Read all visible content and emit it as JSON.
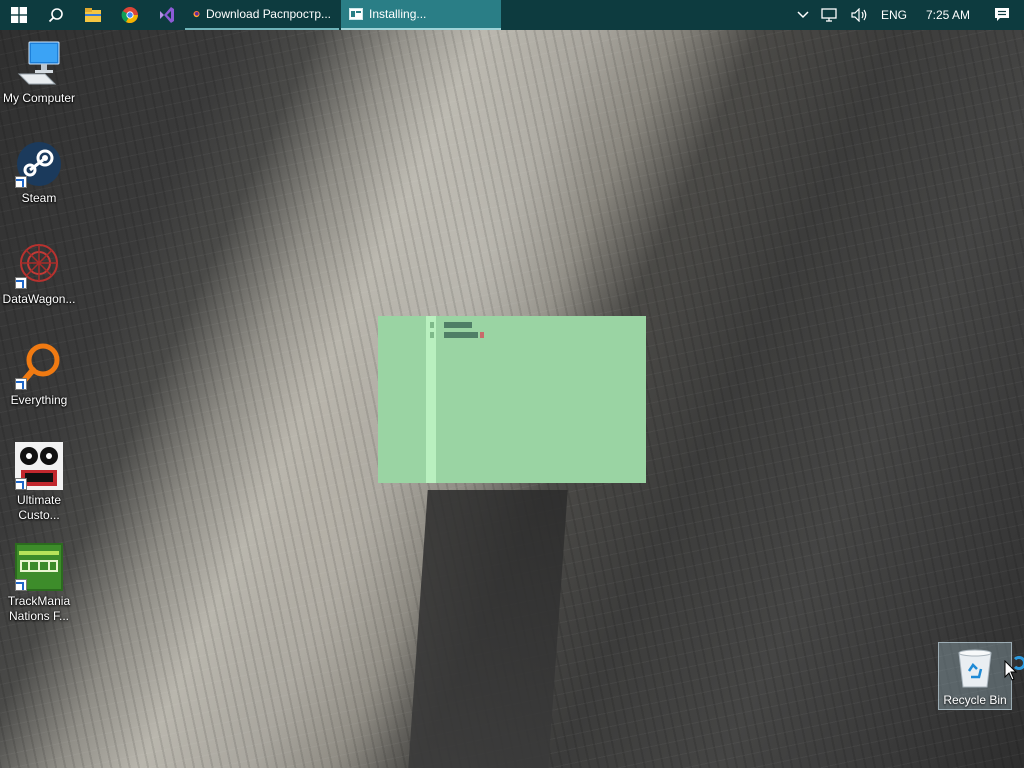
{
  "taskbar": {
    "apps": [
      {
        "label": "Download Распростр...",
        "icon": "firefox-icon"
      },
      {
        "label": "Installing...",
        "icon": "installer-window-icon"
      }
    ],
    "pinned": [
      "start-icon",
      "search-icon",
      "file-explorer-icon",
      "chrome-icon",
      "visual-studio-icon"
    ],
    "tray": {
      "language": "ENG",
      "time": "7:25 AM"
    }
  },
  "desktop": {
    "icons": [
      {
        "name": "my-computer",
        "label": "My Computer"
      },
      {
        "name": "steam",
        "label": "Steam"
      },
      {
        "name": "datawagon",
        "label": "DataWagon..."
      },
      {
        "name": "everything",
        "label": "Everything"
      },
      {
        "name": "ultimate-custom",
        "label": "Ultimate Custo..."
      },
      {
        "name": "trackmania",
        "label": "TrackMania Nations F..."
      }
    ],
    "recycle_bin": {
      "label": "Recycle Bin"
    }
  },
  "colors": {
    "taskbar": "#0d3b3f",
    "active_task": "#2a7e86",
    "installer_bg": "#9ad4a3"
  }
}
